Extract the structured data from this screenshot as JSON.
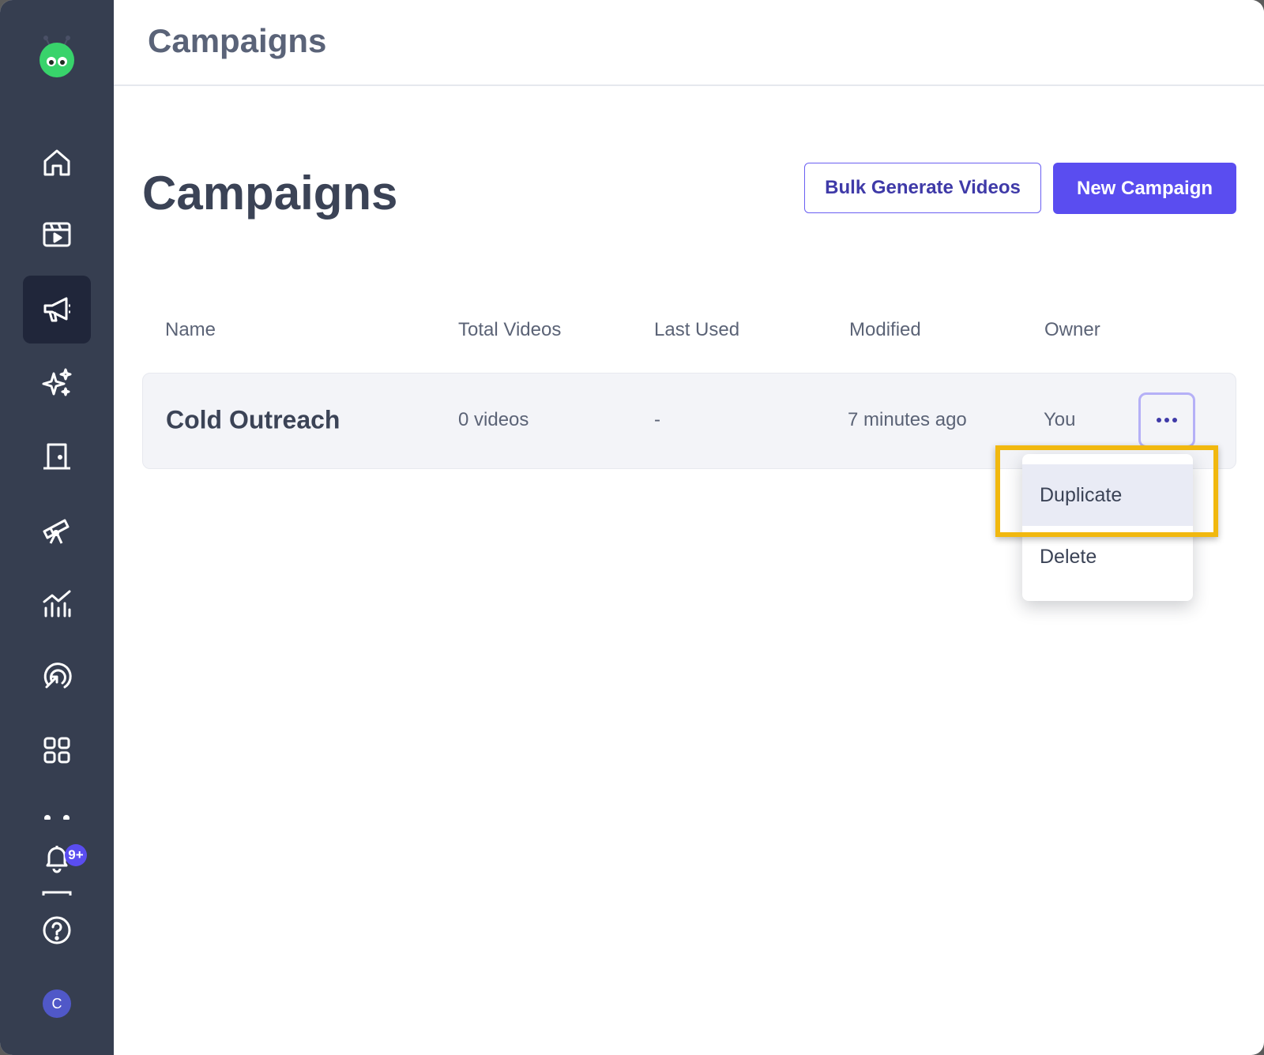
{
  "topbar": {
    "title": "Campaigns"
  },
  "sidebar": {
    "items": [
      {
        "name": "home",
        "icon": "home-icon"
      },
      {
        "name": "videos",
        "icon": "video-clapper-icon"
      },
      {
        "name": "campaigns",
        "icon": "megaphone-icon",
        "active": true
      },
      {
        "name": "ai",
        "icon": "sparkles-icon"
      },
      {
        "name": "rooms",
        "icon": "door-icon"
      },
      {
        "name": "explore",
        "icon": "telescope-icon"
      },
      {
        "name": "analytics",
        "icon": "chart-icon"
      },
      {
        "name": "targeting",
        "icon": "target-cursor-icon"
      },
      {
        "name": "apps",
        "icon": "grid-icon"
      },
      {
        "name": "notifications",
        "icon": "bell-icon",
        "badge": "9+"
      },
      {
        "name": "help",
        "icon": "help-circle-icon"
      }
    ],
    "avatar_initial": "C"
  },
  "page": {
    "title": "Campaigns",
    "bulk_button": "Bulk Generate Videos",
    "new_button": "New Campaign"
  },
  "table": {
    "columns": [
      "Name",
      "Total Videos",
      "Last Used",
      "Modified",
      "Owner"
    ],
    "rows": [
      {
        "name": "Cold Outreach",
        "total_videos": "0 videos",
        "last_used": "-",
        "modified": "7 minutes ago",
        "owner": "You"
      }
    ]
  },
  "menu": {
    "items": [
      "Duplicate",
      "Delete"
    ]
  },
  "colors": {
    "sidebar_bg": "#363e50",
    "accent": "#5a4df0",
    "highlight": "#f1b80f"
  }
}
